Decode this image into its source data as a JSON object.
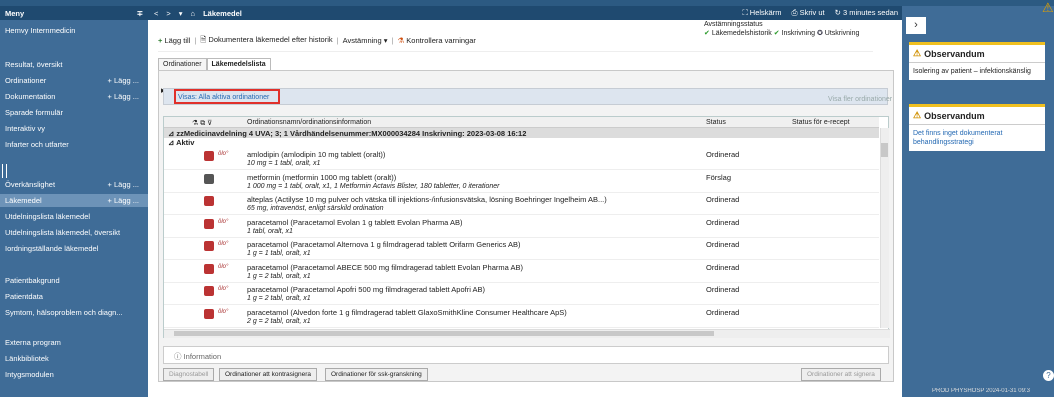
{
  "sidebar": {
    "header": "Meny",
    "pin": "∓",
    "items": [
      {
        "label": "Hemvy Internmedicin",
        "add": ""
      },
      {
        "label": "Resultat, översikt",
        "add": ""
      },
      {
        "label": "Ordinationer",
        "add": "+ Lägg ..."
      },
      {
        "label": "Dokumentation",
        "add": "+ Lägg ..."
      },
      {
        "label": "Sparade formulär",
        "add": ""
      },
      {
        "label": "Interaktiv vy",
        "add": ""
      },
      {
        "label": "Infarter och utfarter",
        "add": ""
      },
      {
        "label": "Överkänslighet",
        "add": "+ Lägg ..."
      },
      {
        "label": "Läkemedel",
        "add": "+ Lägg ..."
      },
      {
        "label": "Utdelningslista läkemedel",
        "add": ""
      },
      {
        "label": "Utdelningslista läkemedel, översikt",
        "add": ""
      },
      {
        "label": "Iordningställande läkemedel",
        "add": ""
      },
      {
        "label": "Patientbakgrund",
        "add": ""
      },
      {
        "label": "Patientdata",
        "add": ""
      },
      {
        "label": "Symtom, hälsoproblem och diagn...",
        "add": ""
      },
      {
        "label": "Externa program",
        "add": ""
      },
      {
        "label": "Länkbibliotek",
        "add": ""
      },
      {
        "label": "Intygsmodulen",
        "add": ""
      }
    ]
  },
  "titlebar": {
    "back": "<",
    "forward": ">",
    "title": "Läkemedel",
    "fullscreen": "Helskärm",
    "print": "Skriv ut",
    "refreshed": "3 minutes sedan"
  },
  "toolbar": {
    "add": "Lägg till",
    "document": "Dokumentera läkemedel efter historik",
    "reconcile": "Avstämning",
    "check": "Kontrollera varningar"
  },
  "sync": {
    "label": "Avstämningsstatus",
    "history": "Läkemedelshistorik",
    "inscription": "Inskrivning",
    "discharge": "Utskrivning"
  },
  "tabs": [
    "Ordinationer",
    "Läkemedelslista"
  ],
  "filter": {
    "text": "Visas: Alla aktiva ordinationer",
    "more": "Visa fler ordinationer"
  },
  "grid": {
    "headers": {
      "name": "Ordinationsnamn/ordinationsinformation",
      "status": "Status",
      "erecept": "Status för e-recept"
    },
    "group": "zzMedicinavdelning 4 UVA; 3; 1  Vårdhändelsenummer:MX000034284  Inskrivning: 2023-03-08 16:12",
    "subgroup": "Aktiv",
    "rows": [
      {
        "name": "amlodipin (amlodipin 10 mg tablett (oralt))",
        "dose": "10 mg = 1 tabl, oralt, x1",
        "status": "Ordinerad",
        "badge": "ölo°",
        "color": "#b33"
      },
      {
        "name": "metformin (metformin 1000 mg tablett (oralt))",
        "dose": "1 000 mg = 1 tabl, oralt, x1, 1 Metformin Actavis Blister, 180 tabletter, 0 iterationer",
        "status": "Förslag",
        "badge": "",
        "color": "#555"
      },
      {
        "name": "alteplas (Actilyse 10 mg pulver och vätska till injektions-/infusionsvätska, lösning Boehringer Ingelheim AB...)",
        "dose": "65 mg, intravenöst, enligt särskild ordination",
        "status": "Ordinerad",
        "badge": "",
        "color": "#b33"
      },
      {
        "name": "paracetamol (Paracetamol Evolan 1 g tablett Evolan Pharma AB)",
        "dose": "1 tabl, oralt, x1",
        "status": "Ordinerad",
        "badge": "ölo°",
        "color": "#b33"
      },
      {
        "name": "paracetamol (Paracetamol Alternova 1 g filmdragerad tablett Orifarm Generics AB)",
        "dose": "1 g = 1 tabl, oralt, x1",
        "status": "Ordinerad",
        "badge": "ölo°",
        "color": "#b33"
      },
      {
        "name": "paracetamol (Paracetamol ABECE 500 mg filmdragerad tablett Evolan Pharma AB)",
        "dose": "1 g = 2 tabl, oralt, x1",
        "status": "Ordinerad",
        "badge": "ölo°",
        "color": "#b33"
      },
      {
        "name": "paracetamol (Paracetamol Apofri 500 mg filmdragerad tablett Apofri AB)",
        "dose": "1 g = 2 tabl, oralt, x1",
        "status": "Ordinerad",
        "badge": "ölo°",
        "color": "#b33"
      },
      {
        "name": "paracetamol (Alvedon forte 1 g filmdragerad tablett GlaxoSmithKline Consumer Healthcare ApS)",
        "dose": "2 g = 2 tabl, oralt, x1",
        "status": "Ordinerad",
        "badge": "ölo°",
        "color": "#b33"
      }
    ]
  },
  "info": "Information",
  "buttons": {
    "diag": "Diagnostabell",
    "countersign": "Ordinationer att kontrasignera",
    "review": "Ordinationer för ssk-granskning",
    "sign": "Ordinationer att signera"
  },
  "observandum": [
    {
      "title": "Observandum",
      "body": "Isolering av patient – infektionskänslig"
    },
    {
      "title": "Observandum",
      "body": "Det finns inget dokumenterat behandlingsstrategi"
    }
  ],
  "prod": "PROD  PHYSHOSP  2024-01-31  09:3"
}
